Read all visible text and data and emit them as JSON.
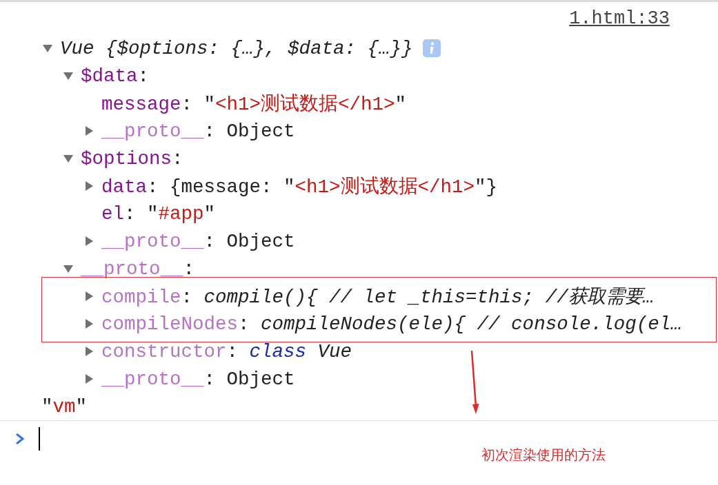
{
  "console": {
    "source_link": "1.html:33",
    "tree": {
      "segments": [
        {
          "kind": "preview",
          "text": "Vue {$options: {…}, $data: {…}}"
        }
      ],
      "info_icon": true,
      "expanded": true,
      "children": [
        {
          "segments": [
            {
              "kind": "key",
              "text": "$data"
            },
            {
              "kind": "plain",
              "text": ":"
            }
          ],
          "expanded": true,
          "children": [
            {
              "segments": [
                {
                  "kind": "key",
                  "text": "message"
                },
                {
                  "kind": "plain",
                  "text": ": \""
                },
                {
                  "kind": "string",
                  "text": "<h1>测试数据</h1>"
                },
                {
                  "kind": "plain",
                  "text": "\""
                }
              ]
            },
            {
              "segments": [
                {
                  "kind": "proto_key",
                  "text": "__proto__"
                },
                {
                  "kind": "plain",
                  "text": ": Object"
                }
              ],
              "expanded": false
            }
          ]
        },
        {
          "segments": [
            {
              "kind": "key",
              "text": "$options"
            },
            {
              "kind": "plain",
              "text": ":"
            }
          ],
          "expanded": true,
          "children": [
            {
              "segments": [
                {
                  "kind": "key",
                  "text": "data"
                },
                {
                  "kind": "plain",
                  "text": ": {message: \""
                },
                {
                  "kind": "string",
                  "text": "<h1>测试数据</h1>"
                },
                {
                  "kind": "plain",
                  "text": "\"}"
                }
              ],
              "expanded": false
            },
            {
              "segments": [
                {
                  "kind": "key",
                  "text": "el"
                },
                {
                  "kind": "plain",
                  "text": ": \""
                },
                {
                  "kind": "string",
                  "text": "#app"
                },
                {
                  "kind": "plain",
                  "text": "\""
                }
              ]
            },
            {
              "segments": [
                {
                  "kind": "proto_key",
                  "text": "__proto__"
                },
                {
                  "kind": "plain",
                  "text": ": Object"
                }
              ],
              "expanded": false
            }
          ]
        },
        {
          "segments": [
            {
              "kind": "proto_key",
              "text": "__proto__"
            },
            {
              "kind": "plain",
              "text": ":"
            }
          ],
          "expanded": true,
          "children": [
            {
              "segments": [
                {
                  "kind": "proto_key",
                  "text": "compile"
                },
                {
                  "kind": "plain",
                  "text": ": "
                },
                {
                  "kind": "italic",
                  "text": "compile(){ // let _this=this; //获取需要…"
                }
              ],
              "expanded": false
            },
            {
              "segments": [
                {
                  "kind": "proto_key",
                  "text": "compileNodes"
                },
                {
                  "kind": "plain",
                  "text": ": "
                },
                {
                  "kind": "italic",
                  "text": "compileNodes(ele){ // console.log(el…"
                }
              ],
              "expanded": false
            },
            {
              "segments": [
                {
                  "kind": "proto_key",
                  "text": "constructor"
                },
                {
                  "kind": "plain",
                  "text": ": "
                },
                {
                  "kind": "keyword",
                  "text": "class"
                },
                {
                  "kind": "italic",
                  "text": " Vue"
                }
              ],
              "expanded": false
            },
            {
              "segments": [
                {
                  "kind": "proto_key",
                  "text": "__proto__"
                },
                {
                  "kind": "plain",
                  "text": ": Object"
                }
              ],
              "expanded": false
            }
          ]
        }
      ]
    },
    "result": [
      {
        "kind": "plain",
        "text": "\""
      },
      {
        "kind": "string",
        "text": "vm"
      },
      {
        "kind": "plain",
        "text": "\""
      }
    ]
  },
  "annotation": {
    "label": "初次渲染使用的方法"
  }
}
